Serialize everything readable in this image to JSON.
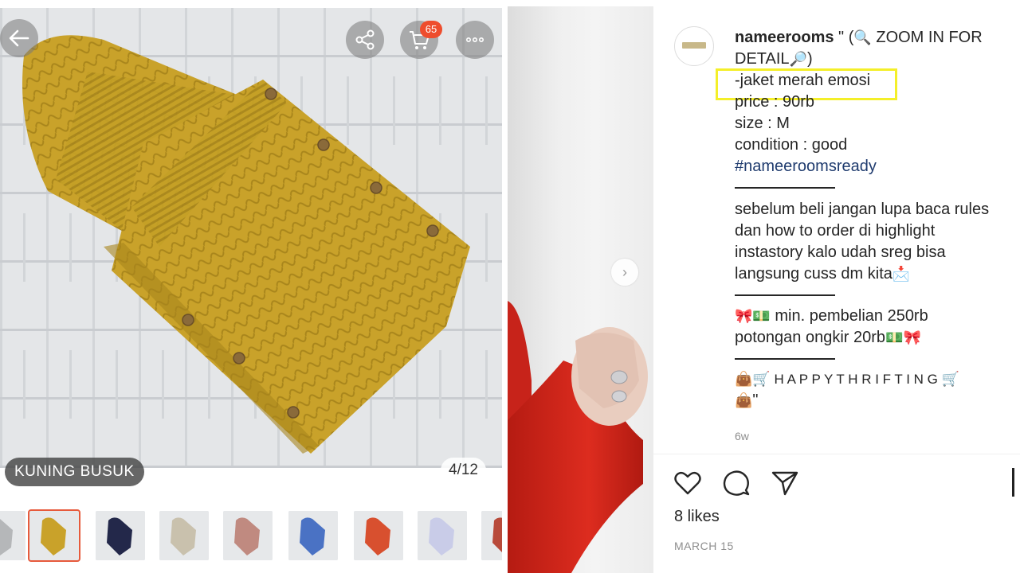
{
  "product_viewer": {
    "variant_label": "KUNING BUSUK",
    "image_counter": "4/12",
    "cart_count": "65",
    "back_icon": "arrow-left-icon",
    "share_icon": "share-icon",
    "cart_icon": "cart-icon",
    "more_icon": "more-dots-icon",
    "thumbnail_colors": [
      "#b5b7b9",
      "#c9a22a",
      "#23284a",
      "#c9c1ad",
      "#c08a80",
      "#4a72c4",
      "#d8502f",
      "#c9cce8",
      "#b84a3a"
    ],
    "selected_thumbnail_index": 1
  },
  "post": {
    "username": "nameerooms",
    "caption_lines": {
      "l1_text": " \" (",
      "l1_zoom": "🔍",
      "l1_text2": " ZOOM IN FOR",
      "l2_text": "DETAIL",
      "l2_zoom": "🔎",
      "l2_text2": ")",
      "item_name": "-jaket merah emosi",
      "price": "price : 90rb",
      "size": "size : M",
      "condition": "condition : good",
      "hashtag": "#nameeroomsready",
      "rules1": "sebelum beli jangan lupa baca rules",
      "rules2": "dan how to order di highlight",
      "rules3": "instastory kalo udah sreg bisa",
      "rules4": "langsung cuss dm kita",
      "rules4_emoji": "📩",
      "promo1_emoji": "🎀💵",
      "promo1": " min. pembelian 250rb",
      "promo2": "potongan ongkir 20rb",
      "promo2_emoji": "💵🎀",
      "happy_emoji_start": "👜🛒",
      "happy": " H A P P Y T H R I F T I N G ",
      "happy_emoji_end": "🛒",
      "last_emoji": "👜",
      "last_text": "\""
    },
    "time_ago": "6w",
    "likes": "8 likes",
    "date": "MARCH 15"
  },
  "accent": {
    "shopee_orange": "#ee4d2d",
    "highlight_yellow": "#f4ef29",
    "sweater_mustard": "#c9a22a",
    "jacket_red": "#d72b1e"
  }
}
